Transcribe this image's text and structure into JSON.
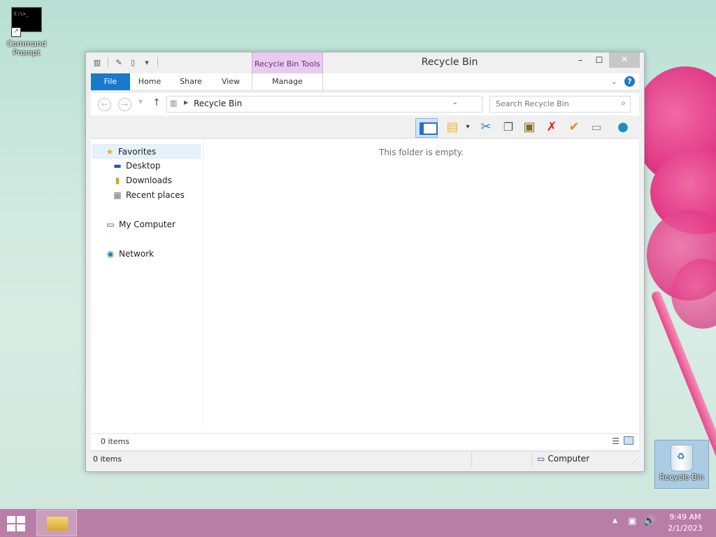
{
  "desktop": {
    "icons": [
      {
        "label": "Command Prompt",
        "glyph": "C:\\>_"
      },
      {
        "label": "Recycle Bin"
      }
    ]
  },
  "window": {
    "title": "Recycle Bin",
    "context_tab_header": "Recycle Bin Tools",
    "controls": {
      "minimize": "–",
      "maximize": "☐",
      "close": "✕"
    },
    "ribbon_tabs": [
      "File",
      "Home",
      "Share",
      "View",
      "Manage"
    ],
    "help_label": "?",
    "address": {
      "path": "Recycle Bin"
    },
    "search": {
      "placeholder": "Search Recycle Bin"
    },
    "nav_pane": {
      "favorites": "Favorites",
      "favorites_items": [
        "Desktop",
        "Downloads",
        "Recent places"
      ],
      "computer": "My Computer",
      "network": "Network"
    },
    "empty_message": "This folder is empty.",
    "items_count": "0 items",
    "status": {
      "items_count": "0 items",
      "location": "Computer"
    }
  },
  "taskbar": {
    "time": "9:49 AM",
    "date": "2/1/2023"
  },
  "colors": {
    "file_tab": "#1979ca",
    "context_tab": "#e8cbef",
    "taskbar": "#b97ea6"
  }
}
